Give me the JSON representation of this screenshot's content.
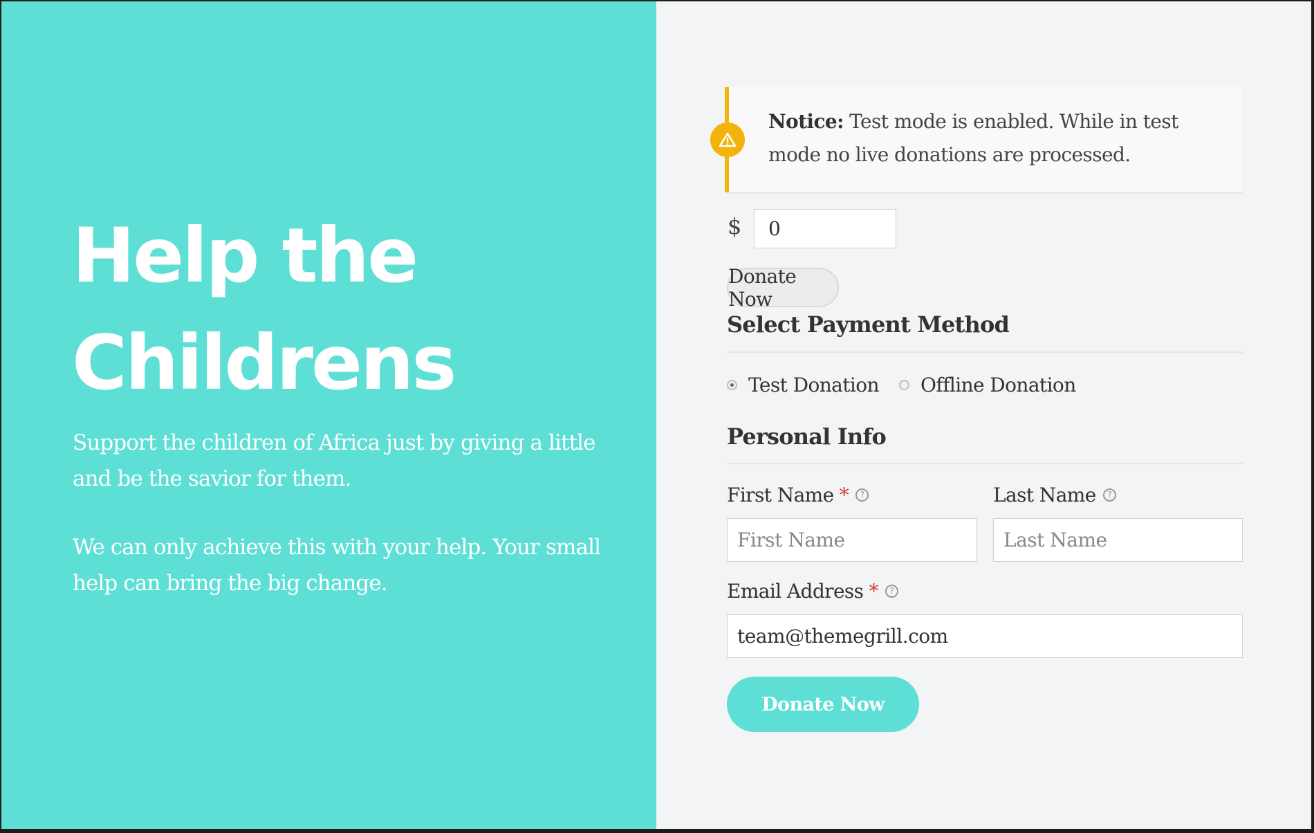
{
  "hero": {
    "title_line1": "Help the",
    "title_line2": "Childrens",
    "paragraph1": "Support the children of Africa just by giving a little and be the savior for them.",
    "paragraph2": "We can only achieve this with your help. Your small help can bring the big change."
  },
  "notice": {
    "icon": "warning-icon",
    "label": "Notice:",
    "message": "Test mode is enabled. While in test mode no live donations are processed."
  },
  "amount": {
    "currency_symbol": "$",
    "value": "0"
  },
  "buttons": {
    "donate_top_label": "Donate Now",
    "donate_submit_label": "Donate Now"
  },
  "payment": {
    "title": "Select Payment Method",
    "options": [
      {
        "label": "Test Donation",
        "selected": true
      },
      {
        "label": "Offline Donation",
        "selected": false
      }
    ]
  },
  "personal": {
    "title": "Personal Info",
    "first_name": {
      "label": "First Name",
      "required_mark": "*",
      "placeholder": "First Name",
      "value": ""
    },
    "last_name": {
      "label": "Last Name",
      "placeholder": "Last Name",
      "value": ""
    },
    "email": {
      "label": "Email Address",
      "required_mark": "*",
      "value": "team@themegrill.com"
    },
    "help_glyph": "?"
  },
  "colors": {
    "accent": "#5ddfd5",
    "notice": "#f4b30b",
    "required": "#d33b2c",
    "panel_bg": "#f3f4f5"
  }
}
